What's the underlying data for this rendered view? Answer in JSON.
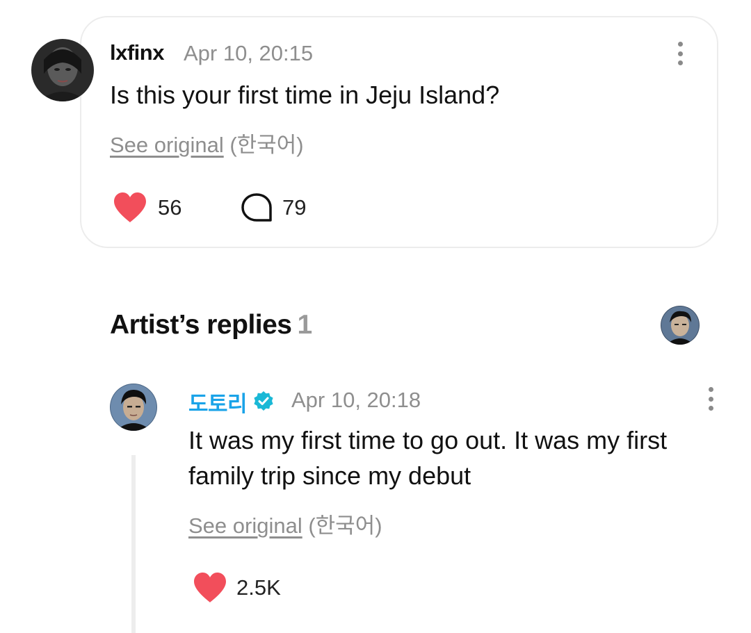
{
  "comment": {
    "username": "lxfinx",
    "timestamp": "Apr 10, 20:15",
    "text": "Is this your first time in Jeju Island?",
    "see_original": "See original",
    "language": "(한국어)",
    "likes": "56",
    "replies": "79",
    "icons": {
      "like": "heart-icon",
      "reply": "speech-bubble-icon",
      "menu": "more-vertical-icon"
    }
  },
  "artist_replies": {
    "title": "Artist’s replies",
    "count": "1",
    "reply": {
      "name": "도토리",
      "verified_icon": "verified-badge-icon",
      "timestamp": "Apr 10, 20:18",
      "text": "It was my first time to go out. It was my first family trip since my debut",
      "see_original": "See original",
      "language": "(한국어)",
      "likes": "2.5K"
    }
  },
  "colors": {
    "heart": "#f24e5b",
    "artist_name": "#1aa3e8",
    "verified": "#1ab8d6",
    "muted_text": "#8e8e8e"
  }
}
